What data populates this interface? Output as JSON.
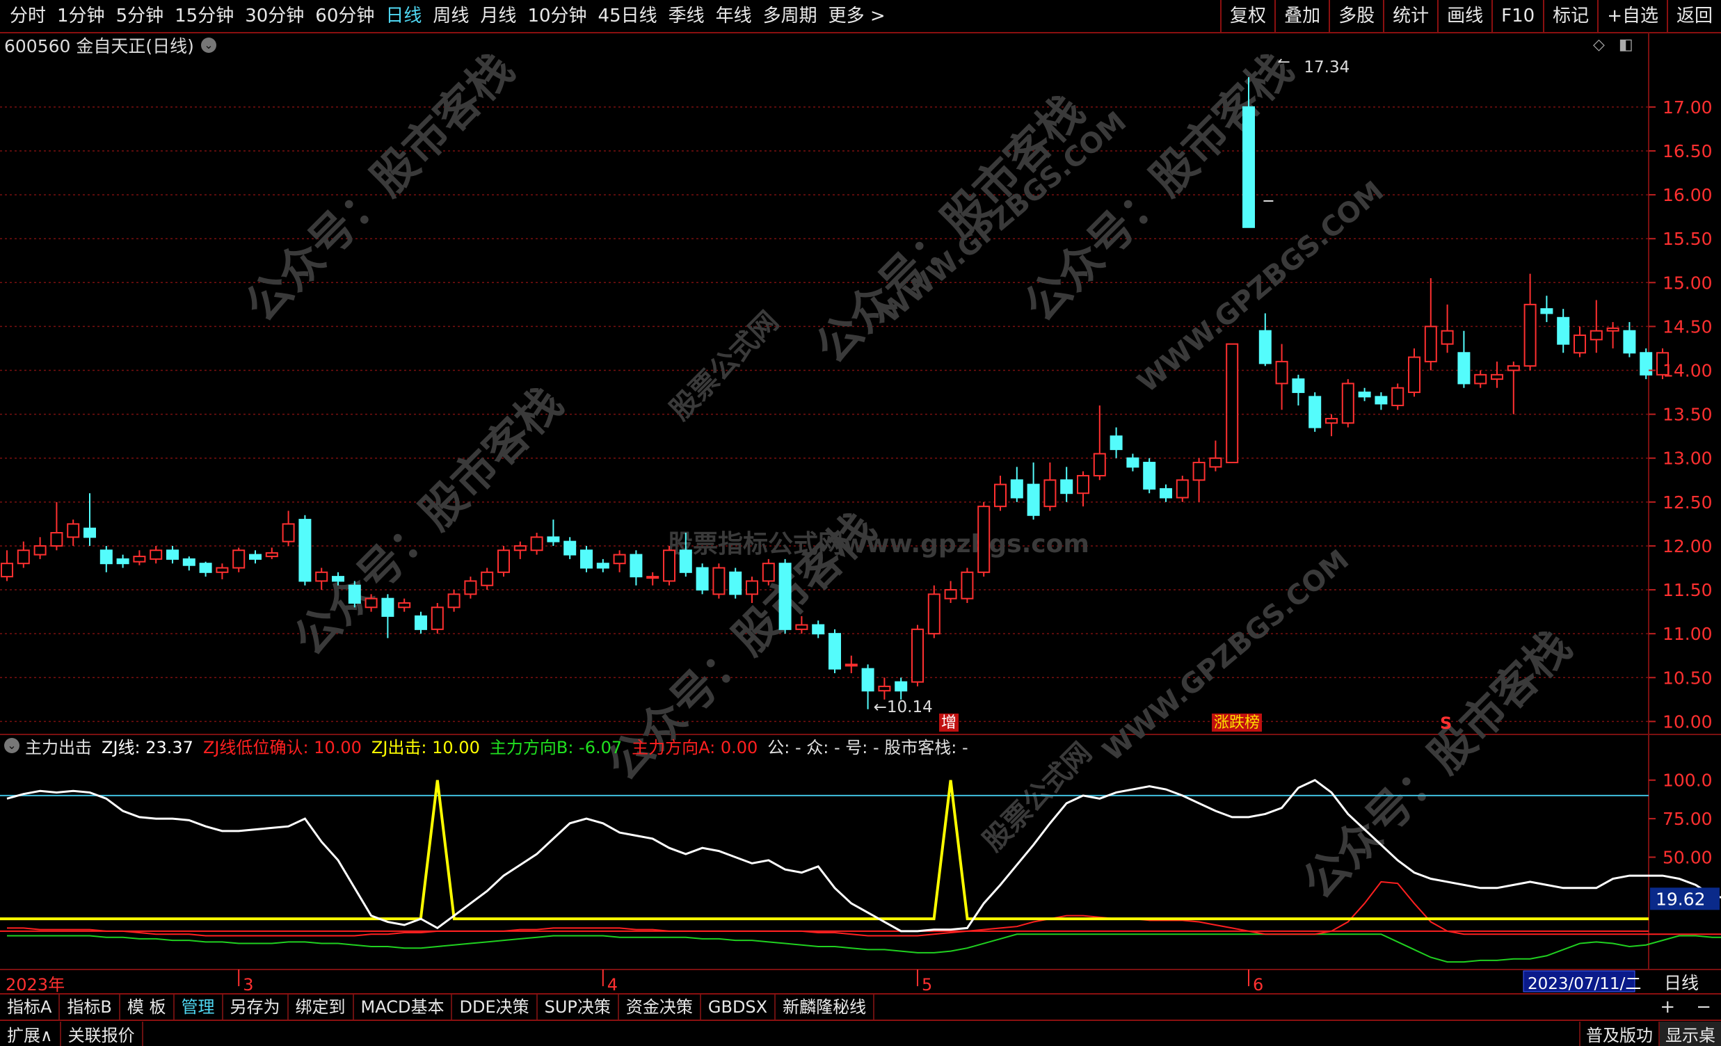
{
  "toolbar": {
    "tabs": [
      "分时",
      "1分钟",
      "5分钟",
      "15分钟",
      "30分钟",
      "60分钟",
      "日线",
      "周线",
      "月线",
      "10分钟",
      "45日线",
      "季线",
      "年线",
      "多周期",
      "更多 >"
    ],
    "active_tab": "日线",
    "tools": [
      "复权",
      "叠加",
      "多股",
      "统计",
      "画线",
      "F10",
      "标记",
      "+自选",
      "返回"
    ]
  },
  "stock": {
    "title": "600560 金自天正(日线)"
  },
  "price_axis": {
    "ticks": [
      "17.00",
      "16.50",
      "16.00",
      "15.50",
      "15.00",
      "14.50",
      "14.00",
      "13.50",
      "13.00",
      "12.50",
      "12.00",
      "11.50",
      "11.00",
      "10.50",
      "10.00"
    ]
  },
  "annotations": {
    "high_label": "17.34",
    "low_label": "10.14",
    "mark_zeng": "增",
    "mark_zhangdie": "涨跌榜",
    "mark_s": "S"
  },
  "watermarks": [
    "公众号：股市客栈",
    "股票指标公式网www.gpzbgs.com",
    "WWW.GPZBGS.COM",
    "股票公式网"
  ],
  "indicator": {
    "name": "主力出击",
    "zj": "ZJ线: 23.37",
    "zj_low": "ZJ线低位确认: 10.00",
    "zj_hit": "ZJ出击: 10.00",
    "dir_b": "主力方向B: -6.07",
    "dir_a": "主力方向A: 0.00",
    "misc": "公: -  众: -  号: -  股市客栈: -",
    "axis_ticks": [
      "100.0",
      "75.00",
      "50.00"
    ],
    "current_value": "19.62"
  },
  "date_axis": {
    "year": "2023年",
    "months": [
      "3",
      "4",
      "5",
      "6"
    ],
    "current_date": "2023/07/11/二",
    "period": "日线"
  },
  "bottom_tabs": [
    "指标A",
    "指标B",
    "模 板",
    "管理",
    "另存为",
    "绑定到",
    "MACD基本",
    "DDE决策",
    "SUP决策",
    "资金决策",
    "GBDSX",
    "新麟隆秘线"
  ],
  "bottom_active": "管理",
  "bottom_right": [
    "+",
    "−"
  ],
  "status": [
    "扩展∧",
    "关联报价"
  ],
  "status_right": [
    "普及版功",
    "显示桌"
  ],
  "colors": {
    "up": "#ff3030",
    "down": "#54fcfc",
    "grid": "#7a1010",
    "zj": "#ffffff",
    "hit": "#ffff00",
    "dir_a": "#ff2020",
    "dir_b": "#20d020",
    "line90": "#40c0e0"
  },
  "chart_data": {
    "type": "candlestick",
    "price_range": [
      9.9,
      17.3
    ],
    "candles": [
      {
        "o": 11.65,
        "c": 11.8,
        "h": 11.95,
        "l": 11.6
      },
      {
        "o": 11.8,
        "c": 11.95,
        "h": 12.05,
        "l": 11.75
      },
      {
        "o": 11.9,
        "c": 12.0,
        "h": 12.1,
        "l": 11.85
      },
      {
        "o": 12.0,
        "c": 12.15,
        "h": 12.5,
        "l": 11.95
      },
      {
        "o": 12.1,
        "c": 12.25,
        "h": 12.3,
        "l": 12.0
      },
      {
        "o": 12.2,
        "c": 12.1,
        "h": 12.6,
        "l": 12.0
      },
      {
        "o": 11.95,
        "c": 11.8,
        "h": 12.0,
        "l": 11.7
      },
      {
        "o": 11.85,
        "c": 11.8,
        "h": 11.9,
        "l": 11.75
      },
      {
        "o": 11.82,
        "c": 11.88,
        "h": 11.95,
        "l": 11.78
      },
      {
        "o": 11.85,
        "c": 11.95,
        "h": 12.0,
        "l": 11.8
      },
      {
        "o": 11.95,
        "c": 11.85,
        "h": 12.0,
        "l": 11.8
      },
      {
        "o": 11.85,
        "c": 11.78,
        "h": 11.88,
        "l": 11.72
      },
      {
        "o": 11.8,
        "c": 11.7,
        "h": 11.82,
        "l": 11.65
      },
      {
        "o": 11.7,
        "c": 11.75,
        "h": 11.8,
        "l": 11.62
      },
      {
        "o": 11.75,
        "c": 11.95,
        "h": 11.98,
        "l": 11.7
      },
      {
        "o": 11.9,
        "c": 11.85,
        "h": 11.95,
        "l": 11.8
      },
      {
        "o": 11.88,
        "c": 11.92,
        "h": 11.98,
        "l": 11.85
      },
      {
        "o": 12.05,
        "c": 12.25,
        "h": 12.4,
        "l": 12.0
      },
      {
        "o": 12.3,
        "c": 11.6,
        "h": 12.35,
        "l": 11.55
      },
      {
        "o": 11.6,
        "c": 11.7,
        "h": 11.75,
        "l": 11.5
      },
      {
        "o": 11.65,
        "c": 11.6,
        "h": 11.7,
        "l": 11.55
      },
      {
        "o": 11.55,
        "c": 11.35,
        "h": 11.6,
        "l": 11.3
      },
      {
        "o": 11.3,
        "c": 11.4,
        "h": 11.45,
        "l": 11.25
      },
      {
        "o": 11.4,
        "c": 11.2,
        "h": 11.45,
        "l": 10.95
      },
      {
        "o": 11.3,
        "c": 11.35,
        "h": 11.4,
        "l": 11.25
      },
      {
        "o": 11.2,
        "c": 11.05,
        "h": 11.25,
        "l": 11.0
      },
      {
        "o": 11.05,
        "c": 11.3,
        "h": 11.35,
        "l": 11.0
      },
      {
        "o": 11.3,
        "c": 11.45,
        "h": 11.5,
        "l": 11.25
      },
      {
        "o": 11.45,
        "c": 11.6,
        "h": 11.65,
        "l": 11.4
      },
      {
        "o": 11.55,
        "c": 11.7,
        "h": 11.75,
        "l": 11.5
      },
      {
        "o": 11.7,
        "c": 11.95,
        "h": 12.0,
        "l": 11.65
      },
      {
        "o": 11.95,
        "c": 12.0,
        "h": 12.05,
        "l": 11.85
      },
      {
        "o": 11.95,
        "c": 12.1,
        "h": 12.15,
        "l": 11.9
      },
      {
        "o": 12.1,
        "c": 12.05,
        "h": 12.3,
        "l": 12.0
      },
      {
        "o": 12.05,
        "c": 11.9,
        "h": 12.1,
        "l": 11.85
      },
      {
        "o": 11.95,
        "c": 11.75,
        "h": 12.0,
        "l": 11.7
      },
      {
        "o": 11.8,
        "c": 11.75,
        "h": 11.85,
        "l": 11.7
      },
      {
        "o": 11.8,
        "c": 11.9,
        "h": 11.95,
        "l": 11.7
      },
      {
        "o": 11.9,
        "c": 11.65,
        "h": 11.95,
        "l": 11.55
      },
      {
        "o": 11.65,
        "c": 11.65,
        "h": 11.7,
        "l": 11.55
      },
      {
        "o": 11.6,
        "c": 11.95,
        "h": 12.0,
        "l": 11.55
      },
      {
        "o": 11.95,
        "c": 11.7,
        "h": 12.15,
        "l": 11.65
      },
      {
        "o": 11.75,
        "c": 11.5,
        "h": 11.8,
        "l": 11.45
      },
      {
        "o": 11.45,
        "c": 11.75,
        "h": 11.8,
        "l": 11.4
      },
      {
        "o": 11.7,
        "c": 11.45,
        "h": 11.75,
        "l": 11.4
      },
      {
        "o": 11.45,
        "c": 11.6,
        "h": 11.65,
        "l": 11.35
      },
      {
        "o": 11.6,
        "c": 11.8,
        "h": 11.85,
        "l": 11.55
      },
      {
        "o": 11.8,
        "c": 11.05,
        "h": 11.85,
        "l": 11.0
      },
      {
        "o": 11.05,
        "c": 11.1,
        "h": 11.2,
        "l": 11.0
      },
      {
        "o": 11.1,
        "c": 11.0,
        "h": 11.15,
        "l": 10.95
      },
      {
        "o": 11.0,
        "c": 10.6,
        "h": 11.05,
        "l": 10.55
      },
      {
        "o": 10.65,
        "c": 10.65,
        "h": 10.75,
        "l": 10.55
      },
      {
        "o": 10.6,
        "c": 10.35,
        "h": 10.65,
        "l": 10.14
      },
      {
        "o": 10.35,
        "c": 10.4,
        "h": 10.5,
        "l": 10.25
      },
      {
        "o": 10.45,
        "c": 10.35,
        "h": 10.5,
        "l": 10.25
      },
      {
        "o": 10.45,
        "c": 11.05,
        "h": 11.1,
        "l": 10.4
      },
      {
        "o": 11.0,
        "c": 11.45,
        "h": 11.55,
        "l": 10.95
      },
      {
        "o": 11.4,
        "c": 11.5,
        "h": 11.6,
        "l": 11.35
      },
      {
        "o": 11.4,
        "c": 11.7,
        "h": 11.75,
        "l": 11.35
      },
      {
        "o": 11.7,
        "c": 12.45,
        "h": 12.5,
        "l": 11.65
      },
      {
        "o": 12.45,
        "c": 12.7,
        "h": 12.8,
        "l": 12.4
      },
      {
        "o": 12.75,
        "c": 12.55,
        "h": 12.9,
        "l": 12.5
      },
      {
        "o": 12.7,
        "c": 12.35,
        "h": 12.95,
        "l": 12.3
      },
      {
        "o": 12.45,
        "c": 12.75,
        "h": 12.95,
        "l": 12.4
      },
      {
        "o": 12.75,
        "c": 12.6,
        "h": 12.9,
        "l": 12.5
      },
      {
        "o": 12.6,
        "c": 12.8,
        "h": 12.85,
        "l": 12.45
      },
      {
        "o": 12.8,
        "c": 13.05,
        "h": 13.6,
        "l": 12.75
      },
      {
        "o": 13.25,
        "c": 13.1,
        "h": 13.35,
        "l": 13.0
      },
      {
        "o": 13.0,
        "c": 12.9,
        "h": 13.05,
        "l": 12.85
      },
      {
        "o": 12.95,
        "c": 12.65,
        "h": 13.0,
        "l": 12.6
      },
      {
        "o": 12.65,
        "c": 12.55,
        "h": 12.7,
        "l": 12.5
      },
      {
        "o": 12.55,
        "c": 12.75,
        "h": 12.8,
        "l": 12.5
      },
      {
        "o": 12.75,
        "c": 12.95,
        "h": 13.0,
        "l": 12.5
      },
      {
        "o": 12.9,
        "c": 13.0,
        "h": 13.2,
        "l": 12.85
      },
      {
        "o": 12.95,
        "c": 14.3,
        "h": 14.3,
        "l": 12.95
      },
      {
        "o": 17.0,
        "c": 15.63,
        "h": 17.34,
        "l": 15.63
      },
      {
        "o": 14.45,
        "c": 14.08,
        "h": 14.65,
        "l": 14.05
      },
      {
        "o": 13.85,
        "c": 14.1,
        "h": 14.3,
        "l": 13.55
      },
      {
        "o": 13.9,
        "c": 13.75,
        "h": 13.95,
        "l": 13.6
      },
      {
        "o": 13.7,
        "c": 13.35,
        "h": 13.75,
        "l": 13.3
      },
      {
        "o": 13.4,
        "c": 13.45,
        "h": 13.5,
        "l": 13.25
      },
      {
        "o": 13.4,
        "c": 13.85,
        "h": 13.9,
        "l": 13.35
      },
      {
        "o": 13.75,
        "c": 13.7,
        "h": 13.8,
        "l": 13.65
      },
      {
        "o": 13.7,
        "c": 13.62,
        "h": 13.75,
        "l": 13.55
      },
      {
        "o": 13.6,
        "c": 13.8,
        "h": 13.85,
        "l": 13.55
      },
      {
        "o": 13.75,
        "c": 14.15,
        "h": 14.25,
        "l": 13.7
      },
      {
        "o": 14.1,
        "c": 14.5,
        "h": 15.05,
        "l": 14.0
      },
      {
        "o": 14.3,
        "c": 14.45,
        "h": 14.75,
        "l": 14.2
      },
      {
        "o": 14.2,
        "c": 13.85,
        "h": 14.45,
        "l": 13.8
      },
      {
        "o": 13.85,
        "c": 13.95,
        "h": 14.0,
        "l": 13.8
      },
      {
        "o": 13.9,
        "c": 13.95,
        "h": 14.1,
        "l": 13.8
      },
      {
        "o": 14.0,
        "c": 14.05,
        "h": 14.1,
        "l": 13.5
      },
      {
        "o": 14.05,
        "c": 14.75,
        "h": 15.1,
        "l": 14.0
      },
      {
        "o": 14.7,
        "c": 14.65,
        "h": 14.85,
        "l": 14.55
      },
      {
        "o": 14.6,
        "c": 14.3,
        "h": 14.7,
        "l": 14.2
      },
      {
        "o": 14.2,
        "c": 14.4,
        "h": 14.5,
        "l": 14.15
      },
      {
        "o": 14.35,
        "c": 14.45,
        "h": 14.8,
        "l": 14.2
      },
      {
        "o": 14.45,
        "c": 14.48,
        "h": 14.55,
        "l": 14.25
      },
      {
        "o": 14.45,
        "c": 14.2,
        "h": 14.55,
        "l": 14.15
      },
      {
        "o": 14.2,
        "c": 13.95,
        "h": 14.25,
        "l": 13.9
      },
      {
        "o": 13.95,
        "c": 14.2,
        "h": 14.25,
        "l": 13.9
      }
    ],
    "zj_line": [
      88,
      91,
      93,
      92,
      93,
      92,
      88,
      80,
      76,
      75,
      75,
      74,
      70,
      67,
      67,
      68,
      69,
      70,
      75,
      60,
      48,
      30,
      12,
      8,
      6,
      10,
      4,
      12,
      20,
      28,
      38,
      45,
      52,
      62,
      72,
      75,
      72,
      66,
      64,
      62,
      56,
      52,
      56,
      54,
      50,
      46,
      48,
      42,
      40,
      44,
      30,
      20,
      14,
      8,
      2,
      2,
      3,
      3,
      4,
      20,
      32,
      45,
      58,
      72,
      85,
      90,
      88,
      92,
      94,
      96,
      94,
      90,
      85,
      80,
      76,
      76,
      78,
      82,
      95,
      100,
      92,
      78,
      68,
      58,
      48,
      40,
      36,
      34,
      32,
      30,
      30,
      32,
      34,
      32,
      30,
      30,
      30,
      36,
      38,
      38,
      38,
      36,
      32,
      25,
      23
    ],
    "hit_line_value": 10,
    "hit_spikes": [
      26,
      57
    ],
    "dir_a": [
      4,
      4,
      3,
      3,
      3,
      3,
      2,
      2,
      1,
      0,
      0,
      0,
      -1,
      -1,
      -1,
      -1,
      -1,
      -1,
      -1,
      -1,
      -1,
      -1,
      0,
      0,
      1,
      1,
      2,
      2,
      2,
      2,
      2,
      3,
      3,
      4,
      4,
      4,
      4,
      4,
      3,
      3,
      2,
      2,
      2,
      2,
      2,
      2,
      2,
      2,
      2,
      1,
      1,
      0,
      -1,
      -1,
      -1,
      -1,
      0,
      1,
      2,
      3,
      4,
      5,
      8,
      10,
      12,
      12,
      11,
      10,
      10,
      9,
      9,
      9,
      8,
      6,
      4,
      2,
      0,
      0,
      0,
      0,
      2,
      8,
      20,
      34,
      33,
      20,
      8,
      2,
      0,
      0,
      0,
      0,
      0,
      0,
      0,
      0,
      0,
      0,
      0,
      0,
      0,
      0,
      0,
      0,
      0,
      0
    ],
    "dir_b": [
      -1,
      -1,
      -1,
      -1,
      -1,
      -1,
      -2,
      -2,
      -3,
      -3,
      -4,
      -4,
      -5,
      -5,
      -6,
      -6,
      -6,
      -5,
      -5,
      -6,
      -6,
      -7,
      -8,
      -8,
      -9,
      -9,
      -8,
      -7,
      -6,
      -5,
      -4,
      -3,
      -2,
      -1,
      -1,
      -1,
      -1,
      -2,
      -2,
      -2,
      -2,
      -2,
      -3,
      -3,
      -4,
      -4,
      -5,
      -6,
      -7,
      -8,
      -8,
      -9,
      -10,
      -10,
      -11,
      -12,
      -12,
      -11,
      -9,
      -6,
      -3,
      0,
      0,
      0,
      0,
      0,
      0,
      0,
      0,
      0,
      0,
      0,
      0,
      0,
      0,
      0,
      0,
      0,
      0,
      0,
      0,
      0,
      0,
      0,
      -5,
      -10,
      -15,
      -18,
      -18,
      -17,
      -17,
      -16,
      -16,
      -14,
      -10,
      -6,
      -5,
      -6,
      -8,
      -7,
      -4,
      -1,
      -1,
      -2,
      -2,
      -4,
      -6
    ]
  }
}
